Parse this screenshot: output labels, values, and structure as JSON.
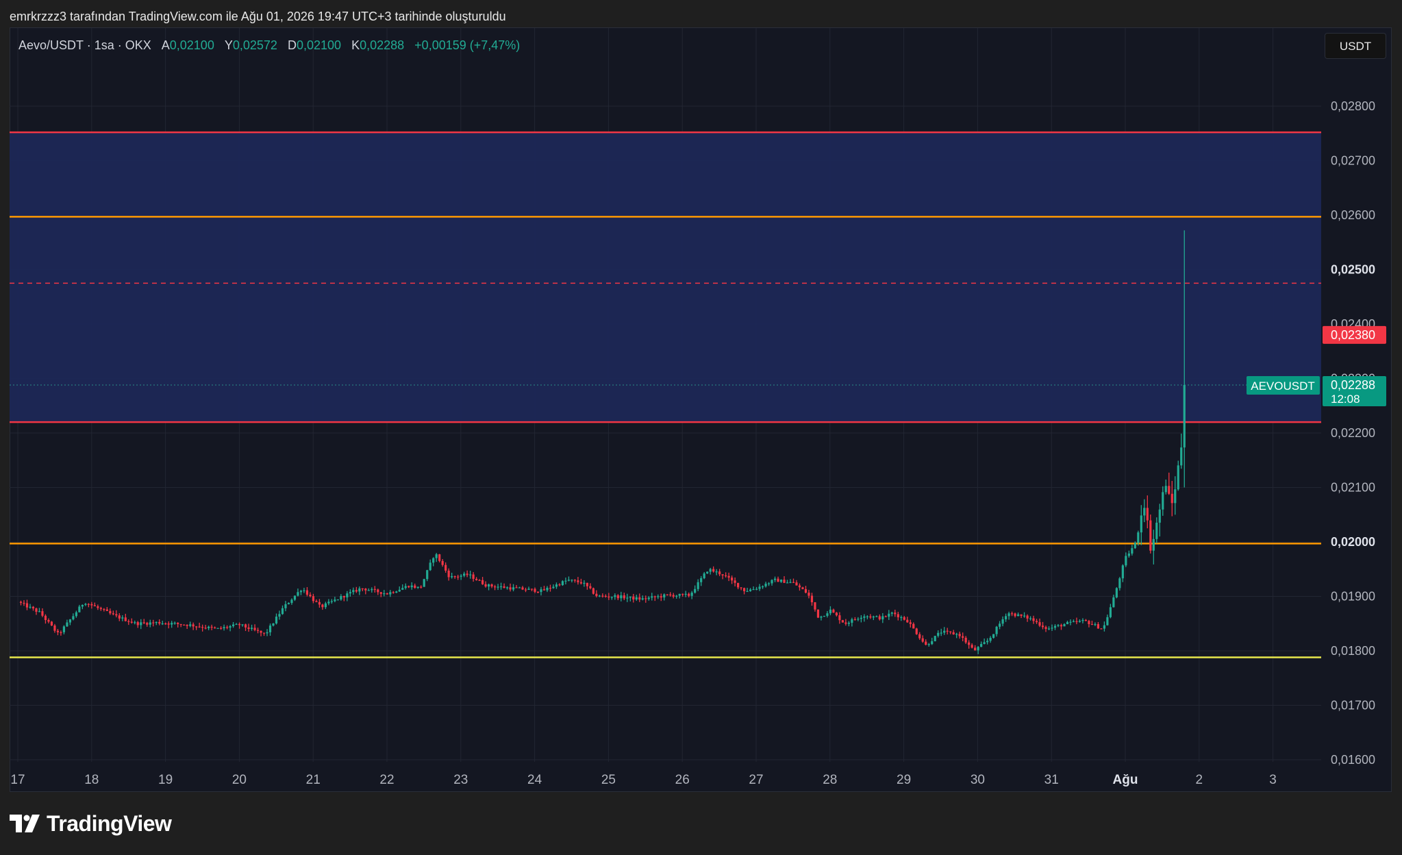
{
  "caption": "emrkrzzz3 tarafından TradingView.com ile Ağu 01, 2026 19:47 UTC+3 tarihinde oluşturuldu",
  "legend": {
    "symbol": "Aevo/USDT · 1sa · OKX",
    "open_label": "A",
    "open": "0,02100",
    "high_label": "Y",
    "high": "0,02572",
    "low_label": "D",
    "low": "0,02100",
    "close_label": "K",
    "close": "0,02288",
    "change": "+0,00159 (+7,47%)"
  },
  "currency_button": "USDT",
  "brand": "TradingView",
  "colors": {
    "up": "#22ab94",
    "down": "#f23645",
    "zone": "#1c2756",
    "red_line": "#f23645",
    "orange_line": "#ff9800",
    "yellow_line": "#e8e84c",
    "background": "#141722",
    "grid": "#222632"
  },
  "chart_data": {
    "type": "candlestick",
    "timeframe": "1h",
    "x_ticks": [
      "17",
      "18",
      "19",
      "20",
      "21",
      "22",
      "23",
      "24",
      "25",
      "26",
      "27",
      "28",
      "29",
      "30",
      "31",
      "Ağu",
      "2",
      "3"
    ],
    "y_ticks": [
      "0,02800",
      "0,02700",
      "0,02600",
      "0,02500",
      "0,02400",
      "0,02300",
      "0,02200",
      "0,02100",
      "0,02000",
      "0,01900",
      "0,01800",
      "0,01700",
      "0,01600"
    ],
    "y_ticks_bold": [
      "0,02500",
      "0,02000"
    ],
    "ylim": [
      0.0158,
      0.0283
    ],
    "zone": {
      "from": 0.0222,
      "to": 0.02752,
      "color": "#1c2756"
    },
    "horizontal_lines": [
      {
        "price": 0.02752,
        "color": "#f23645",
        "style": "solid"
      },
      {
        "price": 0.02597,
        "color": "#ff9800",
        "style": "solid"
      },
      {
        "price": 0.02475,
        "color": "#f23645",
        "style": "dashed"
      },
      {
        "price": 0.0222,
        "color": "#f23645",
        "style": "solid"
      },
      {
        "price": 0.01997,
        "color": "#ff9800",
        "style": "solid"
      },
      {
        "price": 0.01788,
        "color": "#e8e84c",
        "style": "solid"
      }
    ],
    "price_tags": [
      {
        "label": "0,02380",
        "color": "#f23645"
      },
      {
        "label": "0,02288",
        "sublabel": "12:08",
        "symbol_label": "AEVOUSDT",
        "color": "#089981"
      }
    ],
    "last_price": 0.02288,
    "red_tag_price": 0.0238,
    "price_path": [
      [
        17.0,
        0.0189
      ],
      [
        17.3,
        0.0187
      ],
      [
        17.55,
        0.0183
      ],
      [
        17.9,
        0.0189
      ],
      [
        18.3,
        0.01865
      ],
      [
        18.6,
        0.0185
      ],
      [
        18.9,
        0.01852
      ],
      [
        19.3,
        0.01848
      ],
      [
        19.7,
        0.0184
      ],
      [
        20.0,
        0.01848
      ],
      [
        20.35,
        0.0183
      ],
      [
        20.6,
        0.0188
      ],
      [
        20.85,
        0.01915
      ],
      [
        21.1,
        0.0188
      ],
      [
        21.4,
        0.019
      ],
      [
        21.65,
        0.01915
      ],
      [
        22.0,
        0.01905
      ],
      [
        22.3,
        0.0192
      ],
      [
        22.45,
        0.01915
      ],
      [
        22.65,
        0.0198
      ],
      [
        22.85,
        0.01935
      ],
      [
        23.1,
        0.0194
      ],
      [
        23.35,
        0.0192
      ],
      [
        23.7,
        0.01915
      ],
      [
        24.1,
        0.0191
      ],
      [
        24.45,
        0.0193
      ],
      [
        24.65,
        0.01925
      ],
      [
        24.85,
        0.019
      ],
      [
        25.1,
        0.019
      ],
      [
        25.45,
        0.01895
      ],
      [
        25.8,
        0.01902
      ],
      [
        26.1,
        0.01902
      ],
      [
        26.35,
        0.0195
      ],
      [
        26.55,
        0.0194
      ],
      [
        26.85,
        0.0191
      ],
      [
        27.0,
        0.01915
      ],
      [
        27.25,
        0.0193
      ],
      [
        27.5,
        0.01925
      ],
      [
        27.7,
        0.01905
      ],
      [
        27.85,
        0.0186
      ],
      [
        28.0,
        0.01875
      ],
      [
        28.2,
        0.0185
      ],
      [
        28.45,
        0.01865
      ],
      [
        28.7,
        0.0186
      ],
      [
        28.85,
        0.0187
      ],
      [
        29.05,
        0.01855
      ],
      [
        29.3,
        0.0181
      ],
      [
        29.5,
        0.01835
      ],
      [
        29.75,
        0.0183
      ],
      [
        29.95,
        0.018
      ],
      [
        30.15,
        0.0182
      ],
      [
        30.4,
        0.0187
      ],
      [
        30.7,
        0.0186
      ],
      [
        30.95,
        0.0184
      ],
      [
        31.2,
        0.0185
      ],
      [
        31.45,
        0.01855
      ],
      [
        31.7,
        0.0184
      ],
      [
        31.85,
        0.019
      ],
      [
        32.0,
        0.0197
      ],
      [
        32.15,
        0.02
      ],
      [
        32.25,
        0.0208
      ],
      [
        32.35,
        0.01985
      ],
      [
        32.45,
        0.0205
      ],
      [
        32.55,
        0.0211
      ],
      [
        32.62,
        0.0206
      ],
      [
        32.7,
        0.0212
      ],
      [
        32.76,
        0.0218
      ],
      [
        32.8,
        0.02288
      ]
    ],
    "spike": {
      "x": 32.8,
      "high": 0.02572,
      "low": 0.021
    }
  }
}
